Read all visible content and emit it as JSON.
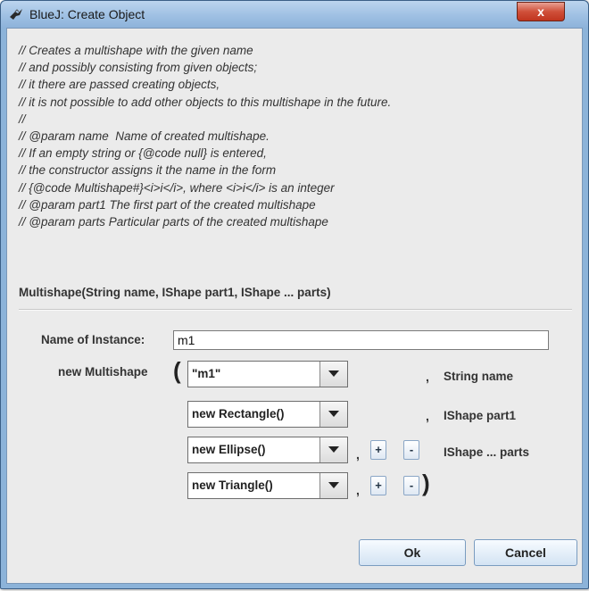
{
  "window": {
    "title": "BlueJ:  Create Object",
    "close_label": "x"
  },
  "comment_lines": [
    "// Creates a multishape with the given name",
    "// and possibly consisting from given objects;",
    "// it there are passed creating objects,",
    "// it is not possible to add other objects to this multishape in the future.",
    "//",
    "// @param name  Name of created multishape.",
    "// If an empty string or {@code null} is entered,",
    "// the constructor assigns it the name in the form",
    "// {@code Multishape#}<i>i</i>, where <i>i</i> is an integer",
    "// @param part1 The first part of the created multishape",
    "// @param parts Particular parts of the created multishape"
  ],
  "signature": "Multishape(String name, IShape part1, IShape ... parts)",
  "instance": {
    "label": "Name of Instance:",
    "value": "m1"
  },
  "constructor": {
    "label": "new Multishape",
    "open_paren": "(",
    "close_paren": ")",
    "comma": ",",
    "plus": "+",
    "minus": "-",
    "params": [
      {
        "value": "\"m1\"",
        "type": "String name"
      },
      {
        "value": "new Rectangle()",
        "type": "IShape part1"
      },
      {
        "value": "new Ellipse()",
        "type": "IShape ... parts"
      },
      {
        "value": "new Triangle()"
      }
    ]
  },
  "buttons": {
    "ok": "Ok",
    "cancel": "Cancel"
  }
}
